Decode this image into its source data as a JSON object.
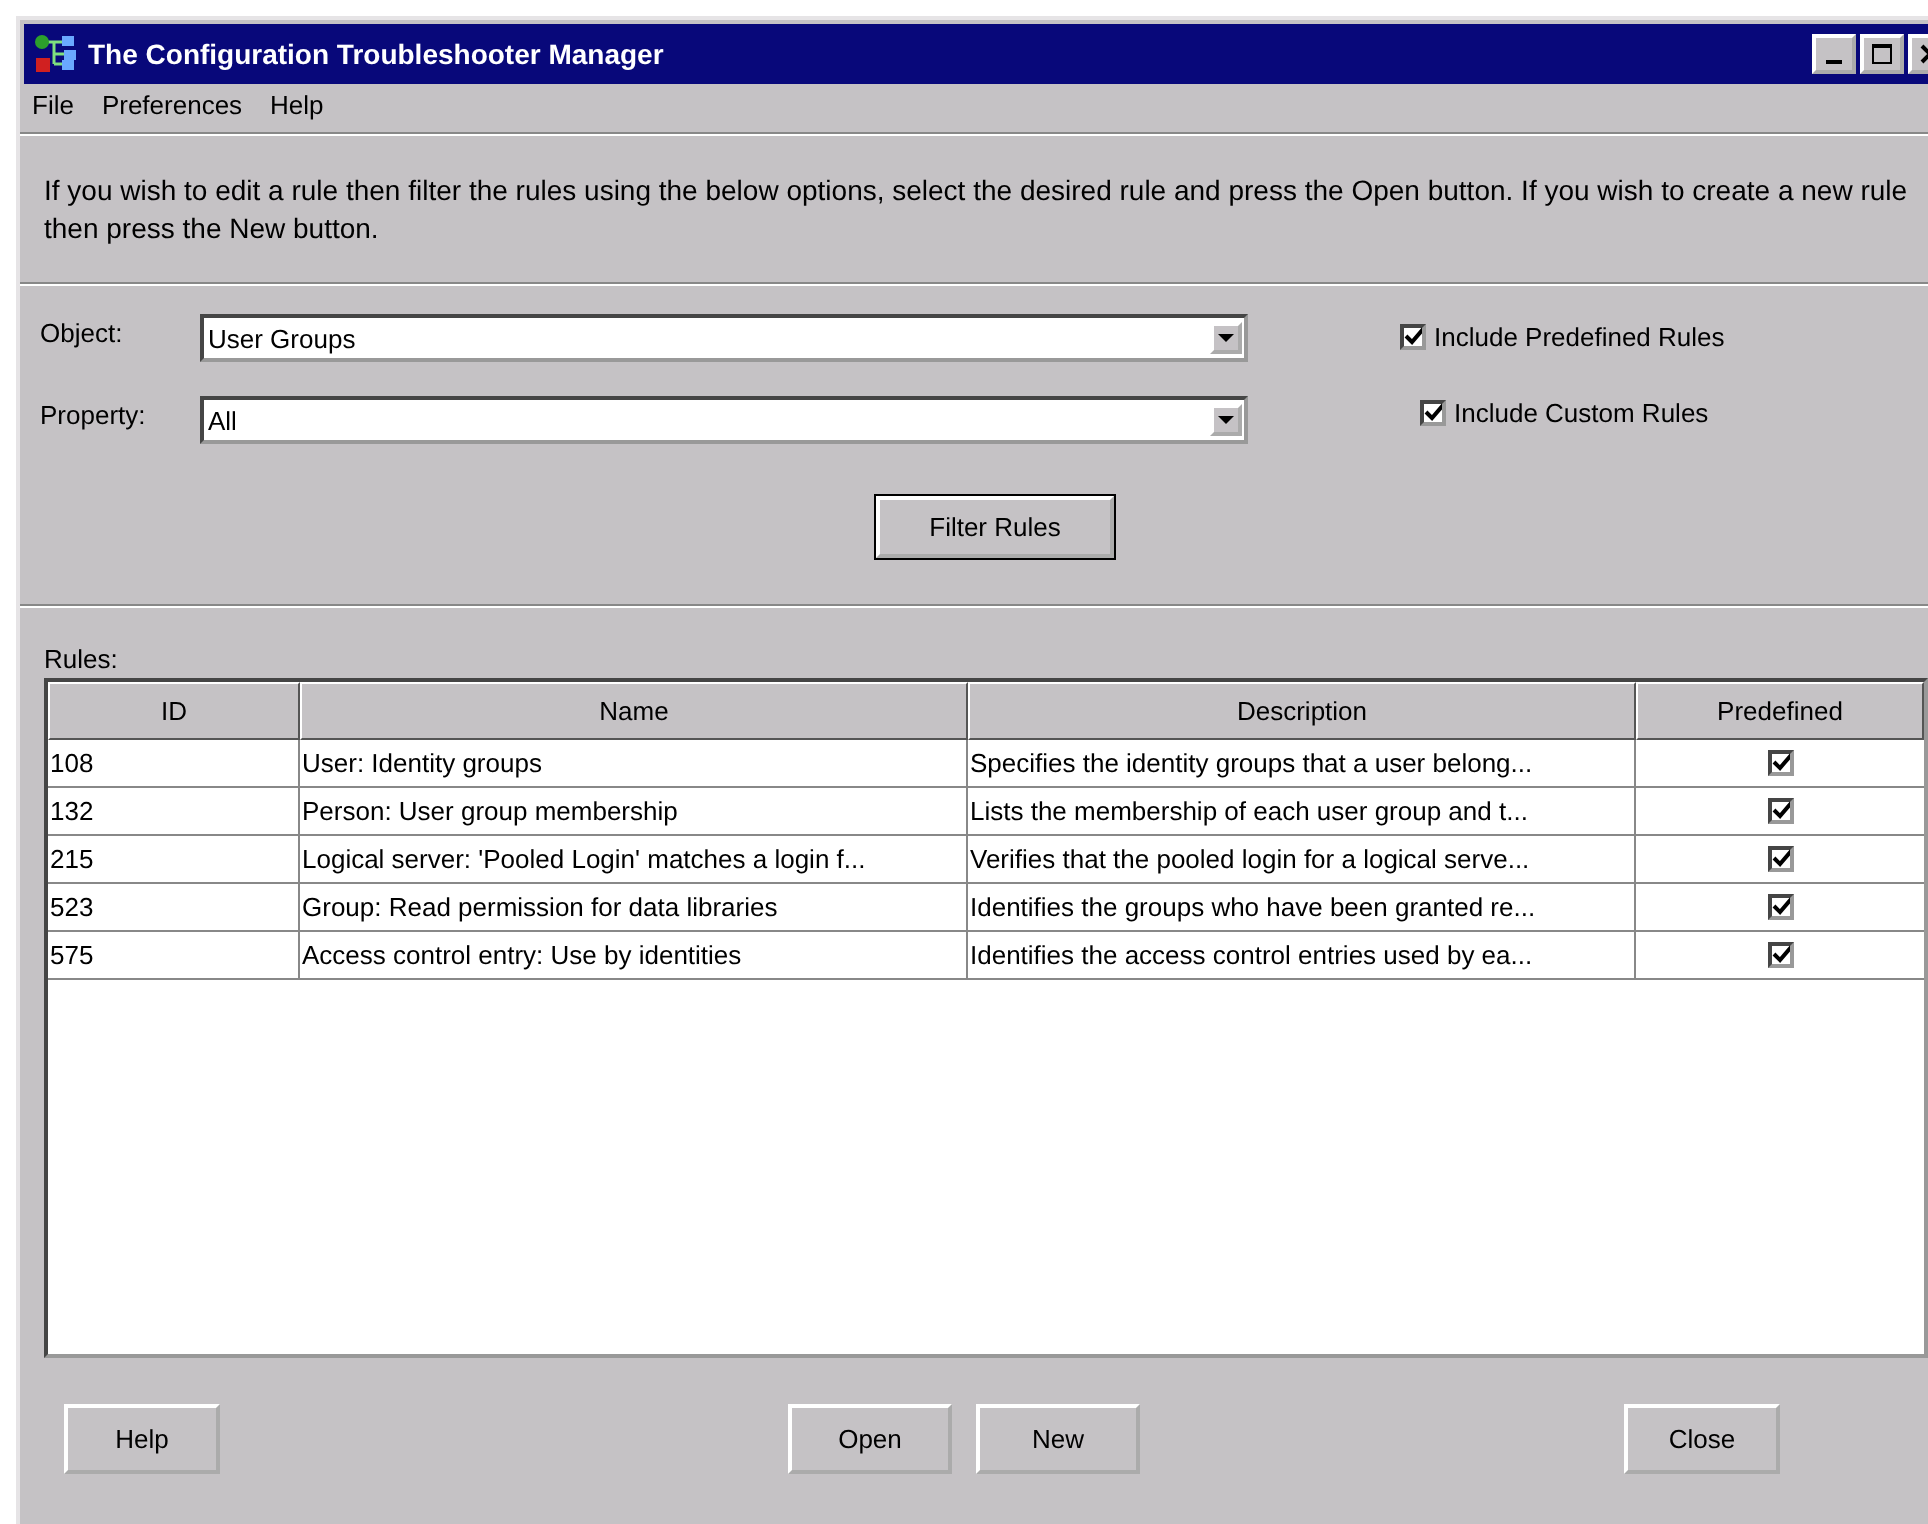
{
  "window": {
    "title": "The Configuration Troubleshooter Manager"
  },
  "menu": [
    "File",
    "Preferences",
    "Help"
  ],
  "instructions": "If you wish to edit a rule then filter the rules using the below options, select the desired rule and press the Open button. If you wish to create a new rule then press the New button.",
  "filters": [
    {
      "label": "Object:",
      "value": "User Groups"
    },
    {
      "label": "Property:",
      "value": "All"
    }
  ],
  "options": [
    {
      "label": "Include Predefined Rules",
      "checked": true
    },
    {
      "label": "Include Custom Rules",
      "checked": true
    }
  ],
  "filter_button": "Filter Rules",
  "rules_label": "Rules:",
  "table": {
    "columns": [
      "ID",
      "Name",
      "Description",
      "Predefined"
    ],
    "rows": [
      {
        "id": "108",
        "name": "User: Identity groups",
        "description": "Specifies the identity groups that a user belong...",
        "predefined": true
      },
      {
        "id": "132",
        "name": "Person: User group membership",
        "description": "Lists the membership of each user group and t...",
        "predefined": true
      },
      {
        "id": "215",
        "name": "Logical server: 'Pooled Login' matches a login f...",
        "description": "Verifies that the pooled login for a logical serve...",
        "predefined": true
      },
      {
        "id": "523",
        "name": "Group: Read permission for data libraries",
        "description": "Identifies the groups who have been granted re...",
        "predefined": true
      },
      {
        "id": "575",
        "name": "Access control entry: Use by identities",
        "description": "Identifies the access control entries used by ea...",
        "predefined": true
      }
    ]
  },
  "buttons": {
    "left": [
      "Help"
    ],
    "center": [
      "Open",
      "New"
    ],
    "right": [
      "Close"
    ]
  }
}
